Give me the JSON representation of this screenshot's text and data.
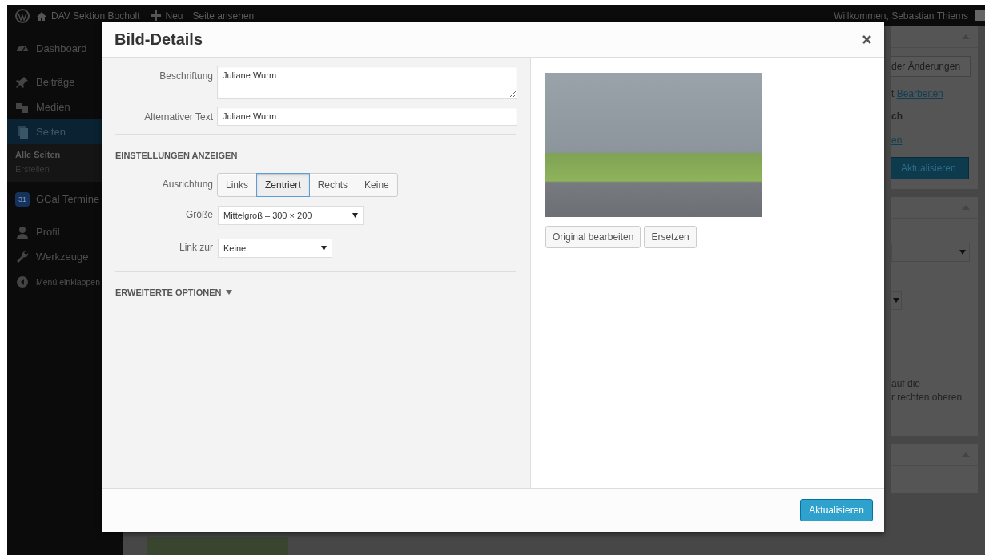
{
  "admin_bar": {
    "site_name": "DAV Sektion Bocholt",
    "new_label": "Neu",
    "view_label": "Seite ansehen",
    "greeting": "Willkommen, Sebastian Thiems"
  },
  "sidebar": {
    "items": [
      {
        "label": "Dashboard",
        "selected": false
      },
      {
        "label": "Beiträge",
        "selected": false
      },
      {
        "label": "Medien",
        "selected": false
      },
      {
        "label": "Seiten",
        "selected": true,
        "children": [
          {
            "label": "Alle Seiten",
            "selected": true
          },
          {
            "label": "Erstellen",
            "selected": false
          }
        ]
      },
      {
        "label": "GCal Termine",
        "selected": false,
        "badge": "31"
      },
      {
        "label": "Profil",
        "selected": false
      },
      {
        "label": "Werkzeuge",
        "selected": false
      },
      {
        "label": "Menü einklappen",
        "selected": false
      }
    ]
  },
  "background_panel": {
    "button_1": "der Änderungen",
    "line_prefix": "t",
    "edit_link": "Bearbeiten",
    "bold_text": "ch",
    "link_2": "en",
    "update_button": "Aktualisieren",
    "help_lines": [
      "auf die",
      "r rechten oberen"
    ]
  },
  "modal": {
    "title": "Bild-Details",
    "fields": [
      {
        "kind": "textarea",
        "label": "Beschriftung",
        "value": "Juliane Wurm"
      },
      {
        "kind": "text",
        "label": "Alternativer Text",
        "value": "Juliane Wurm"
      }
    ],
    "display_heading": "EINSTELLUNGEN ANZEIGEN",
    "alignment": {
      "label": "Ausrichtung",
      "options": [
        {
          "label": "Links",
          "selected": false
        },
        {
          "label": "Zentriert",
          "selected": true
        },
        {
          "label": "Rechts",
          "selected": false
        },
        {
          "label": "Keine",
          "selected": false
        }
      ]
    },
    "size": {
      "label": "Größe",
      "value": "Mittelgroß – 300 × 200"
    },
    "link": {
      "label": "Link zur",
      "value": "Keine"
    },
    "advanced": {
      "label": "ERWEITERTE OPTIONEN",
      "expanded": false
    },
    "image_buttons": [
      "Original bearbeiten",
      "Ersetzen"
    ],
    "footer_button": "Aktualisieren"
  }
}
